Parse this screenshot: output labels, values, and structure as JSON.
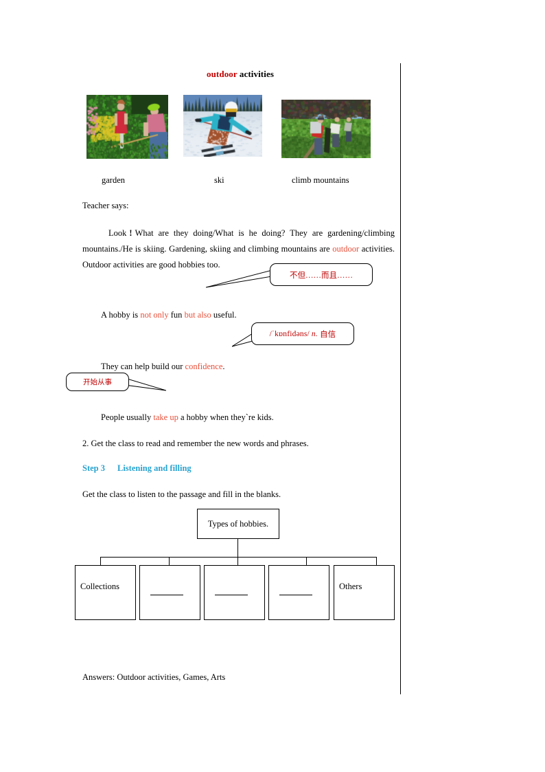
{
  "document": {
    "title_red": "outdoor",
    "title_rest": " activities"
  },
  "photos": [
    {
      "caption": "garden",
      "alt_name": "gardening-photo"
    },
    {
      "caption": "ski",
      "alt_name": "skiing-photo"
    },
    {
      "caption": "climb mountains",
      "alt_name": "mountain-climbing-photo"
    }
  ],
  "body": {
    "teacher_says": "Teacher says:",
    "paragraph": {
      "seg1": "Look",
      "bang": "!",
      "seg2": "What are they doing/What is he doing? They are gardening/climbing mountains./He is skiing. Gardening, skiing and climbing mountains are ",
      "outdoor": "outdoor",
      "seg3": " activities.  Outdoor activities are good hobbies too."
    },
    "line_hobby": {
      "pre": "A hobby is ",
      "not_only": "not only",
      "mid": " fun ",
      "but_also": "but also",
      "post": " useful."
    },
    "line_confidence": {
      "pre": "They can help build our ",
      "word": "confidence",
      "post": "."
    },
    "line_takeup": {
      "pre": "People usually ",
      "phrase": "take up",
      "post": " a hobby when they`re kids."
    },
    "item_2": "2. Get the class to read and remember the new words and phrases.",
    "step_heading": {
      "step": "Step 3",
      "title": "Listening and filling"
    },
    "instruction": "Get the class to listen to the passage and fill in the blanks.",
    "answers": "Answers: Outdoor activities, Games, Arts"
  },
  "callouts": [
    {
      "name": "not-only-but-also-note",
      "text": "不但……而且……"
    },
    {
      "name": "confidence-pronunciation-note",
      "ipa": "/ˈkɒnfidəns/",
      "pos": "n.",
      "meaning": "自信"
    },
    {
      "name": "take-up-note",
      "text": "开始从事"
    }
  ],
  "diagram": {
    "root": "Types of hobbies.",
    "leaves": [
      {
        "label": "Collections",
        "blank": false
      },
      {
        "label": "",
        "blank": true
      },
      {
        "label": "",
        "blank": true
      },
      {
        "label": "",
        "blank": true
      },
      {
        "label": "Others",
        "blank": false
      }
    ]
  },
  "colors": {
    "accent_red": "#c00000",
    "inline_red": "#e8503a",
    "step_blue": "#29a3cf",
    "rule": "#000000"
  }
}
